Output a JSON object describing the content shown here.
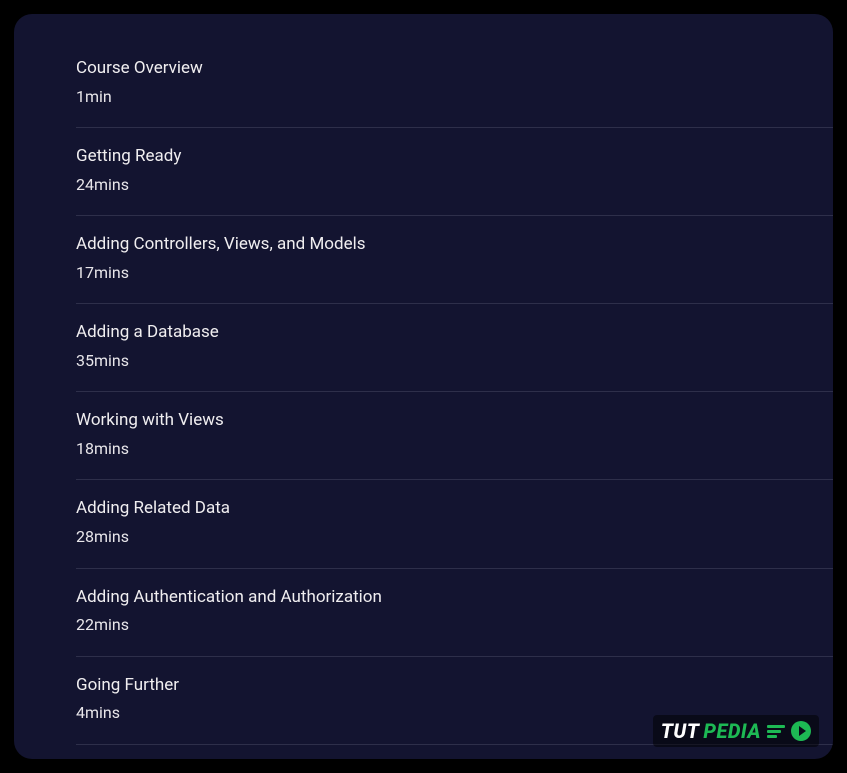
{
  "modules": [
    {
      "title": "Course Overview",
      "duration": "1min"
    },
    {
      "title": "Getting Ready",
      "duration": "24mins"
    },
    {
      "title": "Adding Controllers, Views, and Models",
      "duration": "17mins"
    },
    {
      "title": "Adding a Database",
      "duration": "35mins"
    },
    {
      "title": "Working with Views",
      "duration": "18mins"
    },
    {
      "title": "Adding Related Data",
      "duration": "28mins"
    },
    {
      "title": "Adding Authentication and Authorization",
      "duration": "22mins"
    },
    {
      "title": "Going Further",
      "duration": "4mins"
    }
  ],
  "watermark": {
    "part1": "TUT",
    "part2": "PEDIA"
  }
}
